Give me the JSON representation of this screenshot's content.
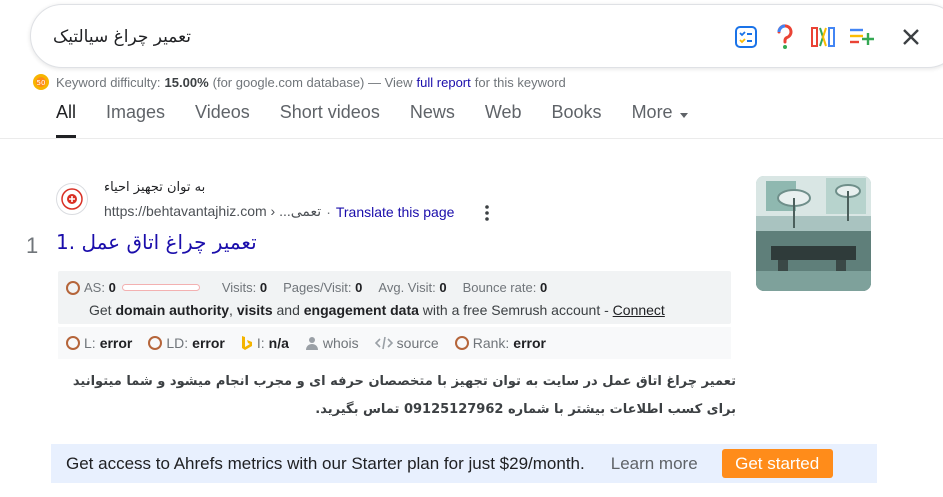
{
  "search": {
    "query": "تعمیر چراغ سیالتیک"
  },
  "colors": {
    "link": "#1a0dab",
    "accent_orange": "#ff8c1a",
    "banner_bg": "#e8f0fe"
  },
  "keyword_difficulty": {
    "label": "Keyword difficulty:",
    "value": "15.00%",
    "suffix": "(for google.com database) — View",
    "link_text": "full report",
    "tail": "for this keyword"
  },
  "tabs": [
    {
      "label": "All",
      "active": true
    },
    {
      "label": "Images"
    },
    {
      "label": "Videos"
    },
    {
      "label": "Short videos"
    },
    {
      "label": "News"
    },
    {
      "label": "Web"
    },
    {
      "label": "Books"
    },
    {
      "label": "More"
    }
  ],
  "result": {
    "rank": "1",
    "site_name": "به توان تجهیز احیاء",
    "url": "https://behtavantajhiz.com › ...تعمی",
    "separator": "·",
    "translate": "Translate this page",
    "title": "1. تعمیر چراغ اتاق عمل",
    "semrush": {
      "as_label": "AS:",
      "as_value": "0",
      "visits_label": "Visits:",
      "visits_value": "0",
      "pages_label": "Pages/Visit:",
      "pages_value": "0",
      "avg_label": "Avg. Visit:",
      "avg_value": "0",
      "bounce_label": "Bounce rate:",
      "bounce_value": "0",
      "cta_prefix": "Get",
      "cta_b1": "domain authority",
      "cta_sep1": ",",
      "cta_b2": "visits",
      "cta_and": "and",
      "cta_b3": "engagement data",
      "cta_suffix": "with a free Semrush account -",
      "cta_link": "Connect"
    },
    "metrics": {
      "l_label": "L:",
      "l_value": "error",
      "ld_label": "LD:",
      "ld_value": "error",
      "i_label": "I:",
      "i_value": "n/a",
      "whois": "whois",
      "source": "source",
      "rank_label": "Rank:",
      "rank_value": "error"
    },
    "snippet": "تعمیر چراغ اتاق عمل در سایت به توان تجهیز با متخصصان حرفه ای و مجرب انجام میشود و شما میتوانید برای کسب اطلاعات بیشتر با شماره 09125127962 تماس بگیرید."
  },
  "ahrefs": {
    "text": "Get access to Ahrefs metrics with our Starter plan for just $29/month.",
    "learn_more": "Learn more",
    "button": "Get started"
  }
}
